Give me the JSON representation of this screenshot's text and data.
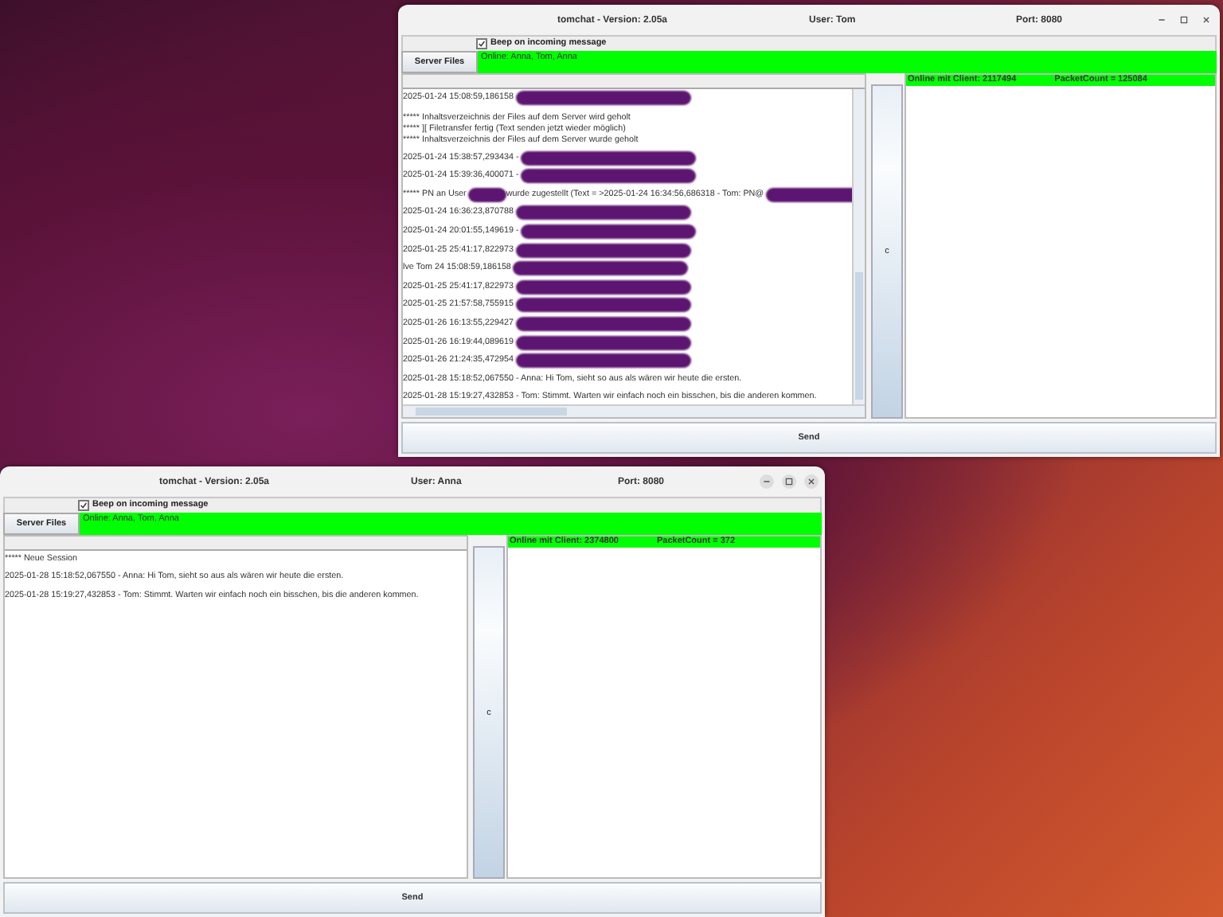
{
  "windows": [
    {
      "title": "tomchat - Version: 2.05a",
      "user": "User:  Tom",
      "port": "Port: 8080",
      "beep": {
        "label": "Beep on incoming message",
        "checked": true
      },
      "server_files_button": "Server Files",
      "online_users": "Online: Anna, Tom, Anna",
      "scrollbars": true,
      "messages": [
        {
          "kind": "message",
          "segments": [
            {
              "kind": "text",
              "text": "2025-01-24 15:08:59,186158"
            },
            {
              "kind": "redacted"
            }
          ]
        },
        {
          "kind": "block",
          "lines": [
            "***** Inhaltsverzeichnis der Files auf dem Server wird geholt",
            "***** ][ Filetransfer fertig (Text senden jetzt wieder möglich)",
            "***** Inhaltsverzeichnis der Files auf dem Server wurde geholt"
          ]
        },
        {
          "kind": "message",
          "segments": [
            {
              "kind": "text",
              "text": "2025-01-24 15:38:57,293434 -"
            },
            {
              "kind": "redacted"
            }
          ]
        },
        {
          "kind": "message",
          "segments": [
            {
              "kind": "text",
              "text": "2025-01-24 15:39:36,400071 -"
            },
            {
              "kind": "redacted"
            }
          ]
        },
        {
          "kind": "message",
          "segments": [
            {
              "kind": "text",
              "text": "***** PN an User"
            },
            {
              "kind": "redacted"
            },
            {
              "kind": "text",
              "text": "wurde zugestellt (Text = >2025-01-24 16:34:56,686318 - Tom: PN@"
            },
            {
              "kind": "redacted"
            }
          ]
        },
        {
          "kind": "message",
          "segments": [
            {
              "kind": "text",
              "text": "2025-01-24 16:36:23,870788"
            },
            {
              "kind": "redacted"
            }
          ]
        },
        {
          "kind": "message",
          "segments": [
            {
              "kind": "text",
              "text": "2025-01-24 20:01:55,149619 -"
            },
            {
              "kind": "redacted"
            }
          ]
        },
        {
          "kind": "message",
          "segments": [
            {
              "kind": "text",
              "text": "2025-01-25 25:41:17,822973"
            },
            {
              "kind": "redacted"
            }
          ]
        },
        {
          "kind": "message",
          "segments": [
            {
              "kind": "text",
              "text": "lve Tom 24 15:08:59,186158"
            },
            {
              "kind": "redacted"
            }
          ]
        },
        {
          "kind": "message",
          "segments": [
            {
              "kind": "text",
              "text": "2025-01-25 25:41:17,822973"
            },
            {
              "kind": "redacted"
            }
          ]
        },
        {
          "kind": "message",
          "segments": [
            {
              "kind": "text",
              "text": "2025-01-25 21:57:58,755915"
            },
            {
              "kind": "redacted"
            }
          ]
        },
        {
          "kind": "message",
          "segments": [
            {
              "kind": "text",
              "text": "2025-01-26 16:13:55,229427"
            },
            {
              "kind": "redacted"
            }
          ]
        },
        {
          "kind": "message",
          "segments": [
            {
              "kind": "text",
              "text": "2025-01-26 16:19:44,089619"
            },
            {
              "kind": "redacted"
            }
          ]
        },
        {
          "kind": "message",
          "segments": [
            {
              "kind": "text",
              "text": "2025-01-26 21:24:35,472954"
            },
            {
              "kind": "redacted"
            }
          ]
        },
        {
          "kind": "message",
          "segments": [
            {
              "kind": "text",
              "text": "2025-01-28 15:18:52,067550 - Anna: Hi Tom, sieht so aus als wären wir heute die ersten."
            }
          ]
        },
        {
          "kind": "message",
          "segments": [
            {
              "kind": "text",
              "text": "2025-01-28 15:19:27,432853 - Tom: Stimmt. Warten wir einfach noch ein bisschen, bis die anderen kommen."
            }
          ]
        }
      ],
      "side_button": "c",
      "client_status": "Online mit Client: 2117494",
      "packet_count": "PacketCount = 125084",
      "send_button": "Send"
    },
    {
      "title": "tomchat - Version: 2.05a",
      "user": "User:  Anna",
      "port": "Port: 8080",
      "beep": {
        "label": "Beep on incoming message",
        "checked": true
      },
      "server_files_button": "Server Files",
      "online_users": "Online: Anna, Tom, Anna",
      "scrollbars": false,
      "messages": [
        {
          "kind": "block",
          "lines": [
            "***** Neue Session"
          ]
        },
        {
          "kind": "message",
          "segments": [
            {
              "kind": "text",
              "text": "2025-01-28 15:18:52,067550 - Anna: Hi Tom, sieht so aus als wären wir heute die ersten."
            }
          ]
        },
        {
          "kind": "message",
          "segments": [
            {
              "kind": "text",
              "text": "2025-01-28 15:19:27,432853 - Tom: Stimmt. Warten wir einfach noch ein bisschen, bis die anderen kommen."
            }
          ]
        }
      ],
      "side_button": "c",
      "client_status": "Online mit Client: 2374800",
      "packet_count": "PacketCount = 372",
      "send_button": "Send"
    }
  ]
}
